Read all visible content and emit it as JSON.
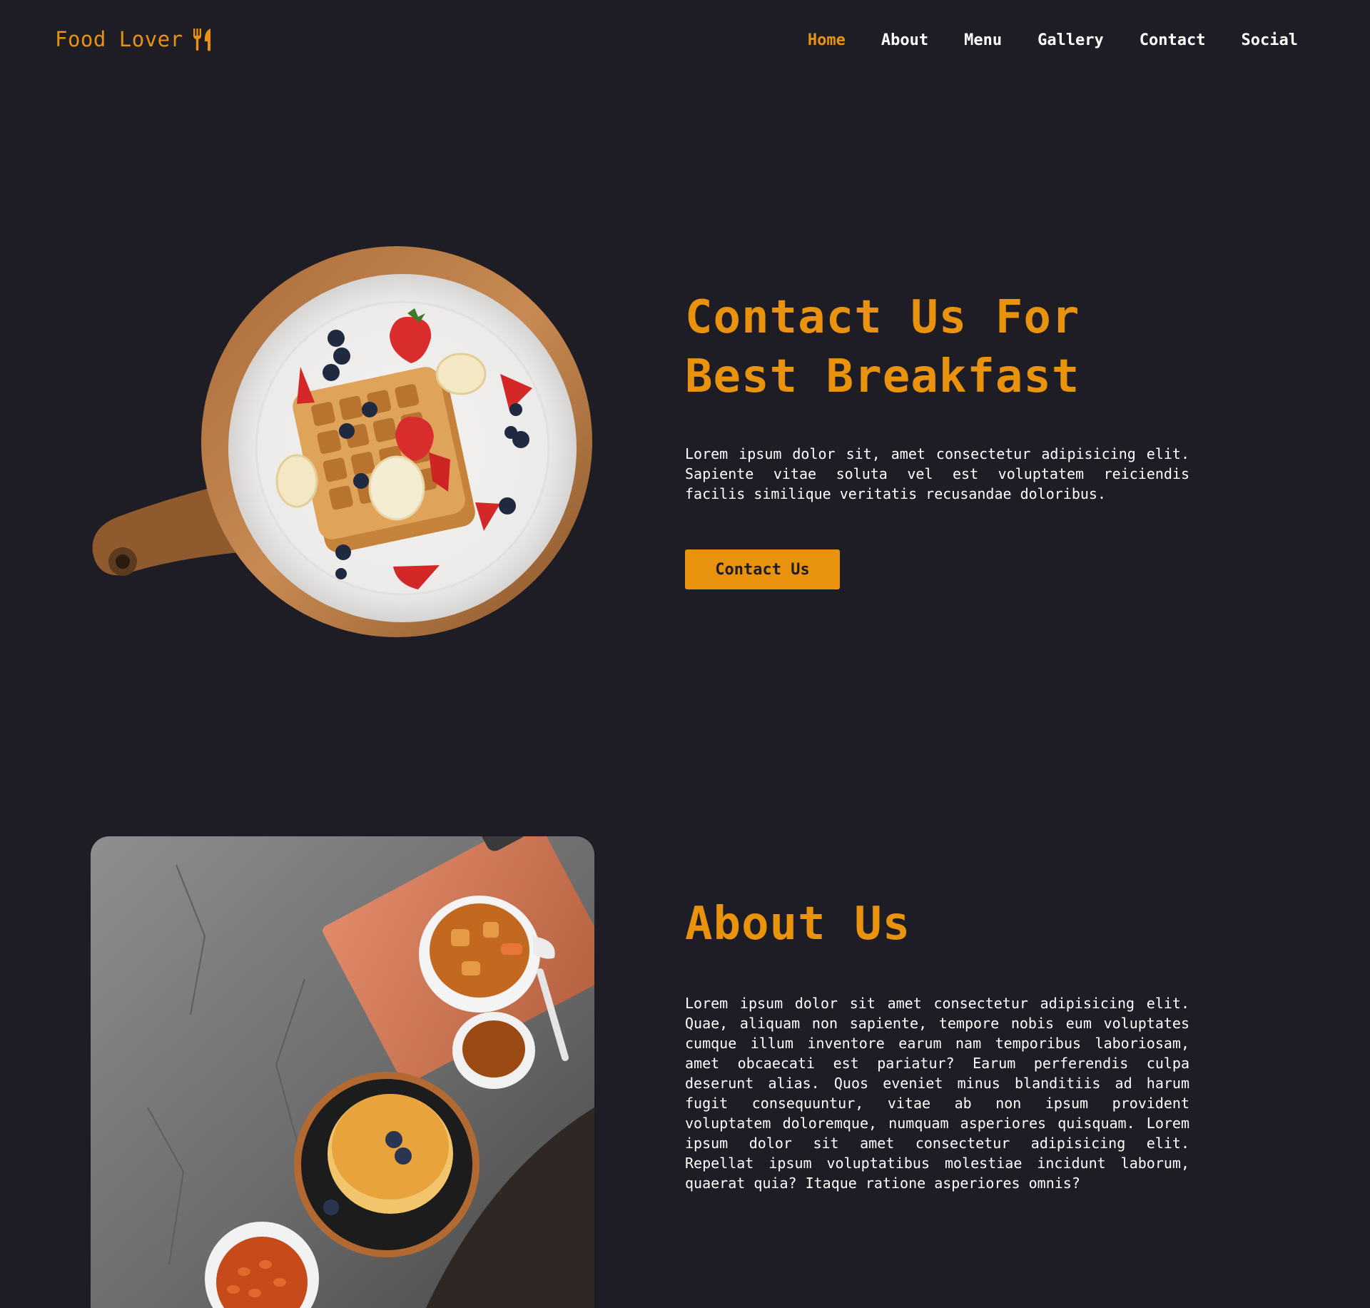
{
  "nav": {
    "brand": "Food Lover",
    "brand_icon": "fork-knife-icon",
    "links": [
      {
        "label": "Home",
        "active": true
      },
      {
        "label": "About",
        "active": false
      },
      {
        "label": "Menu",
        "active": false
      },
      {
        "label": "Gallery",
        "active": false
      },
      {
        "label": "Contact",
        "active": false
      },
      {
        "label": "Social",
        "active": false
      }
    ]
  },
  "hero": {
    "title_line1": "Contact Us For",
    "title_line2": "Best Breakfast",
    "text": "Lorem ipsum dolor sit, amet consectetur adipisicing elit. Sapiente vitae soluta vel est voluptatem reiciendis facilis similique veritatis recusandae doloribus.",
    "button_label": "Contact Us"
  },
  "about": {
    "title": "About Us",
    "text": "Lorem ipsum dolor sit amet consectetur adipisicing elit. Quae, aliquam non sapiente, tempore nobis eum voluptates cumque illum inventore earum nam temporibus laboriosam, amet obcaecati est pariatur? Earum perferendis culpa deserunt alias. Quos eveniet minus blanditiis ad harum fugit consequuntur, vitae ab non ipsum provident voluptatem doloremque, numquam asperiores quisquam. Lorem ipsum dolor sit amet consectetur adipisicing elit. Repellat ipsum voluptatibus molestiae incidunt laborum, quaerat quia? Itaque ratione asperiores omnis?"
  },
  "colors": {
    "background": "#1e1c24",
    "accent": "#e8920d",
    "text": "#ffffff"
  }
}
